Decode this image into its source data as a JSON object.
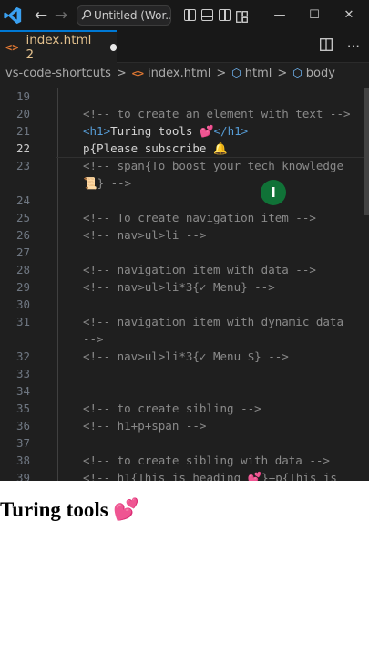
{
  "titlebar": {
    "search_label": "Untitled (Wor...",
    "icons": [
      "vscode-logo",
      "back-arrow",
      "forward-arrow",
      "search-icon",
      "toggle-primary-sidebar-icon",
      "toggle-panel-icon",
      "toggle-secondary-sidebar-icon",
      "customize-layout-icon",
      "minimize-icon",
      "maximize-icon",
      "close-icon"
    ],
    "back": "←",
    "forward": "→",
    "minimize": "—",
    "maximize": "☐",
    "close": "✕"
  },
  "tab": {
    "icon_text": "<>",
    "name": "index.html 2",
    "dirty": true
  },
  "breadcrumb": {
    "items": [
      "vs-code-shortcuts",
      "index.html",
      "html",
      "body"
    ],
    "separator": ">",
    "html_icon_text": "<>",
    "symbol_icon": "⬡"
  },
  "editor": {
    "active_line": "22",
    "lines": [
      {
        "n": "19",
        "parts": []
      },
      {
        "n": "20",
        "parts": [
          {
            "c": "comment",
            "t": "<!-- to create an element with text -->"
          }
        ]
      },
      {
        "n": "21",
        "parts": [
          {
            "c": "tag",
            "t": "<h1>"
          },
          {
            "c": "plain",
            "t": "Turing tools "
          },
          {
            "c": "heart",
            "t": "💕"
          },
          {
            "c": "tag",
            "t": "</h1>"
          }
        ]
      },
      {
        "n": "22",
        "parts": [
          {
            "c": "plain",
            "t": "p{Please subscribe 🔔"
          }
        ]
      },
      {
        "n": "23",
        "parts": [
          {
            "c": "comment",
            "t": "<!-- span{To boost your tech knowledge"
          }
        ]
      },
      {
        "n": "",
        "parts": [
          {
            "c": "comment",
            "t": "📜} -->"
          }
        ]
      },
      {
        "n": "24",
        "parts": []
      },
      {
        "n": "25",
        "parts": [
          {
            "c": "comment",
            "t": "<!-- To create navigation item -->"
          }
        ]
      },
      {
        "n": "26",
        "parts": [
          {
            "c": "comment",
            "t": "<!-- nav>ul>li -->"
          }
        ]
      },
      {
        "n": "27",
        "parts": []
      },
      {
        "n": "28",
        "parts": [
          {
            "c": "comment",
            "t": "<!-- navigation item with data -->"
          }
        ]
      },
      {
        "n": "29",
        "parts": [
          {
            "c": "comment",
            "t": "<!-- nav>ul>li*3{✓ Menu} -->"
          }
        ]
      },
      {
        "n": "30",
        "parts": []
      },
      {
        "n": "31",
        "parts": [
          {
            "c": "comment",
            "t": "<!-- navigation item with dynamic data"
          }
        ]
      },
      {
        "n": "",
        "parts": [
          {
            "c": "comment",
            "t": "-->"
          }
        ]
      },
      {
        "n": "32",
        "parts": [
          {
            "c": "comment",
            "t": "<!-- nav>ul>li*3{✓ Menu $} -->"
          }
        ]
      },
      {
        "n": "33",
        "parts": []
      },
      {
        "n": "34",
        "parts": []
      },
      {
        "n": "35",
        "parts": [
          {
            "c": "comment",
            "t": "<!-- to create sibling -->"
          }
        ]
      },
      {
        "n": "36",
        "parts": [
          {
            "c": "comment",
            "t": "<!-- h1+p+span -->"
          }
        ]
      },
      {
        "n": "37",
        "parts": []
      },
      {
        "n": "38",
        "parts": [
          {
            "c": "comment",
            "t": "<!-- to create sibling with data -->"
          }
        ]
      },
      {
        "n": "39",
        "parts": [
          {
            "c": "comment",
            "t": "<!-- h1{This is heading 💕}+p{This is"
          }
        ]
      }
    ]
  },
  "preview": {
    "heading": "Turing tools",
    "heading_emoji": "💕"
  },
  "colors": {
    "editor_bg": "#1f1f1f",
    "accent": "#0078d4",
    "tab_name": "#e2c08d",
    "comment": "#8a8a8a",
    "tag": "#569cd6",
    "cursor": "#0f7a3a"
  }
}
